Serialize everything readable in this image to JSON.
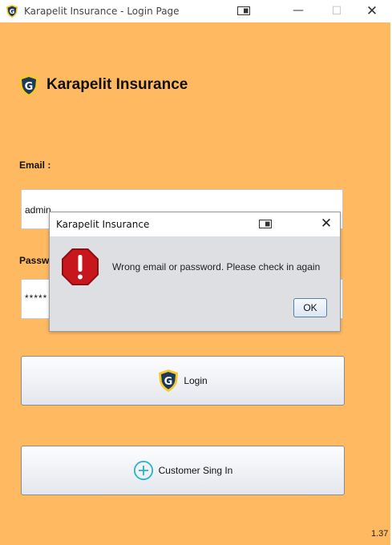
{
  "window": {
    "title": "Karapelit Insurance - Login Page",
    "minimize_glyph": "—",
    "maximize_glyph": "☐",
    "close_glyph": "✕"
  },
  "brand": {
    "name": "Karapelit Insurance",
    "icon": "shield-logo-icon"
  },
  "form": {
    "email_label": "Email :",
    "email_value": "admin",
    "password_label": "Password :",
    "password_value": "*****"
  },
  "buttons": {
    "login_label": "Login",
    "signin_label": "Customer Sing In"
  },
  "version": "1.37",
  "dialog": {
    "title": "Karapelit Insurance",
    "close_glyph": "✕",
    "message": "Wrong email or password. Please check in again",
    "ok_label": "OK",
    "icon": "error-stop-icon"
  },
  "colors": {
    "background": "#ffba61",
    "logo_yellow": "#f7c82b",
    "logo_navy": "#1d3a5a",
    "error_red": "#c8161d",
    "add_icon_teal": "#2bb5c8"
  }
}
